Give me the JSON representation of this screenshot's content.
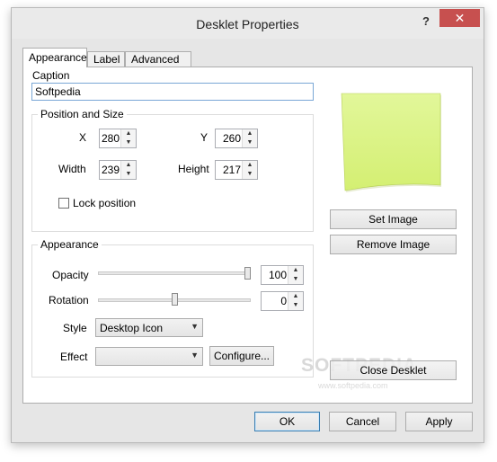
{
  "window": {
    "title": "Desklet Properties",
    "help_label": "?",
    "close_label": "✕"
  },
  "tabs": [
    {
      "label": "Appearance",
      "active": true
    },
    {
      "label": "Label",
      "active": false
    },
    {
      "label": "Advanced",
      "active": false
    }
  ],
  "caption": {
    "label": "Caption",
    "value": "Softpedia"
  },
  "position_size": {
    "group_label": "Position and Size",
    "x_label": "X",
    "x_value": "280",
    "y_label": "Y",
    "y_value": "260",
    "width_label": "Width",
    "width_value": "239",
    "height_label": "Height",
    "height_value": "217",
    "lock_label": "Lock position",
    "lock_checked": false
  },
  "appearance": {
    "group_label": "Appearance",
    "opacity_label": "Opacity",
    "opacity_value": "100",
    "opacity_level": 1.0,
    "rotation_label": "Rotation",
    "rotation_value": "0",
    "rotation_level": 0.5,
    "style_label": "Style",
    "style_value": "Desktop Icon",
    "effect_label": "Effect",
    "effect_value": "",
    "configure_label": "Configure..."
  },
  "image": {
    "set_image_label": "Set Image",
    "remove_image_label": "Remove Image",
    "note_color": "#dcf587"
  },
  "close_desklet_label": "Close Desklet",
  "footer": {
    "ok_label": "OK",
    "cancel_label": "Cancel",
    "apply_label": "Apply"
  },
  "watermark": {
    "text": "SOFTPEDIA",
    "url": "www.softpedia.com"
  },
  "colors": {
    "close_button": "#c7504f",
    "focus_border": "#7aa7d6",
    "default_button_border": "#3c7fb1"
  }
}
